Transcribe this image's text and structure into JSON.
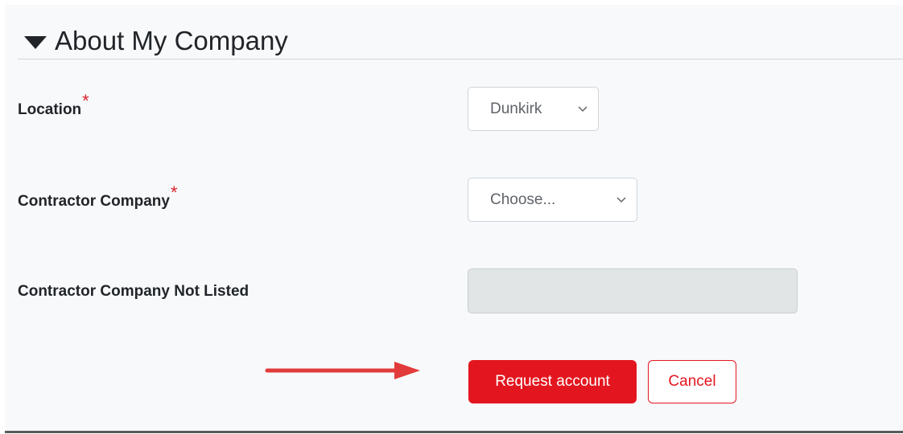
{
  "section": {
    "title": "About My Company",
    "caret_icon": "caret-down-icon"
  },
  "fields": {
    "location": {
      "label": "Location",
      "required_mark": "*",
      "selected_value": "Dunkirk"
    },
    "contractor_company": {
      "label": "Contractor Company",
      "required_mark": "*",
      "selected_value": "Choose..."
    },
    "contractor_not_listed": {
      "label": "Contractor Company Not Listed",
      "value": ""
    }
  },
  "actions": {
    "request_label": "Request account",
    "cancel_label": "Cancel"
  },
  "annotation": {
    "arrow_icon": "red-arrow-icon"
  },
  "colors": {
    "accent": "#e3161f",
    "required": "#d8232a",
    "panel_bg": "#f8f9fa",
    "disabled_input_bg": "#e1e5e6"
  }
}
